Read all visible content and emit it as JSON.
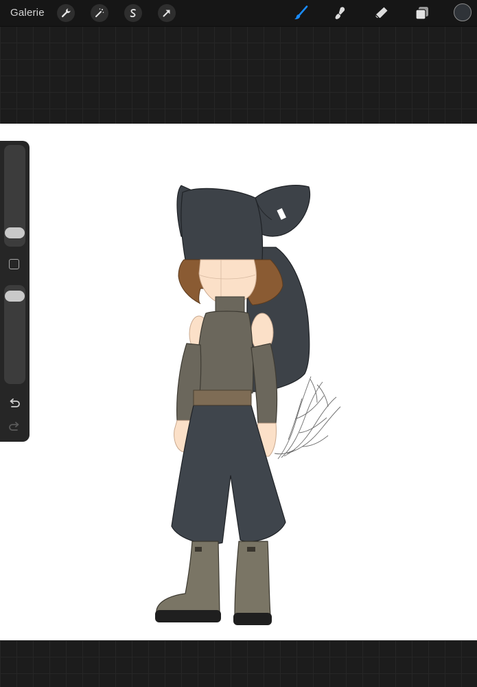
{
  "toolbar": {
    "gallery_label": "Galerie",
    "left_tools": [
      {
        "name": "actions",
        "icon": "wrench-icon"
      },
      {
        "name": "adjustments",
        "icon": "magic-wand-icon"
      },
      {
        "name": "selection",
        "icon": "selection-s-icon"
      },
      {
        "name": "transform",
        "icon": "arrow-cursor-icon"
      }
    ],
    "right_tools": [
      {
        "name": "brush",
        "icon": "brush-icon",
        "active": true
      },
      {
        "name": "smudge",
        "icon": "smudge-icon",
        "active": false
      },
      {
        "name": "eraser",
        "icon": "eraser-icon",
        "active": false
      },
      {
        "name": "layers",
        "icon": "layers-icon",
        "active": false
      }
    ],
    "current_color": "#2f3338"
  },
  "sidebar": {
    "brush_size_level": 0.08,
    "brush_opacity_level": 0.95,
    "modify_icon": "square-icon",
    "undo_icon": "undo-icon",
    "redo_icon": "redo-icon"
  },
  "colors": {
    "accent": "#1a8cff",
    "hood": "#3d4248",
    "top": "#6b675c",
    "pants": "#3f454c",
    "belt": "#7e6c55",
    "boots": "#7a7565",
    "hair": "#8a5b33",
    "skin": "#fbe0c8"
  }
}
